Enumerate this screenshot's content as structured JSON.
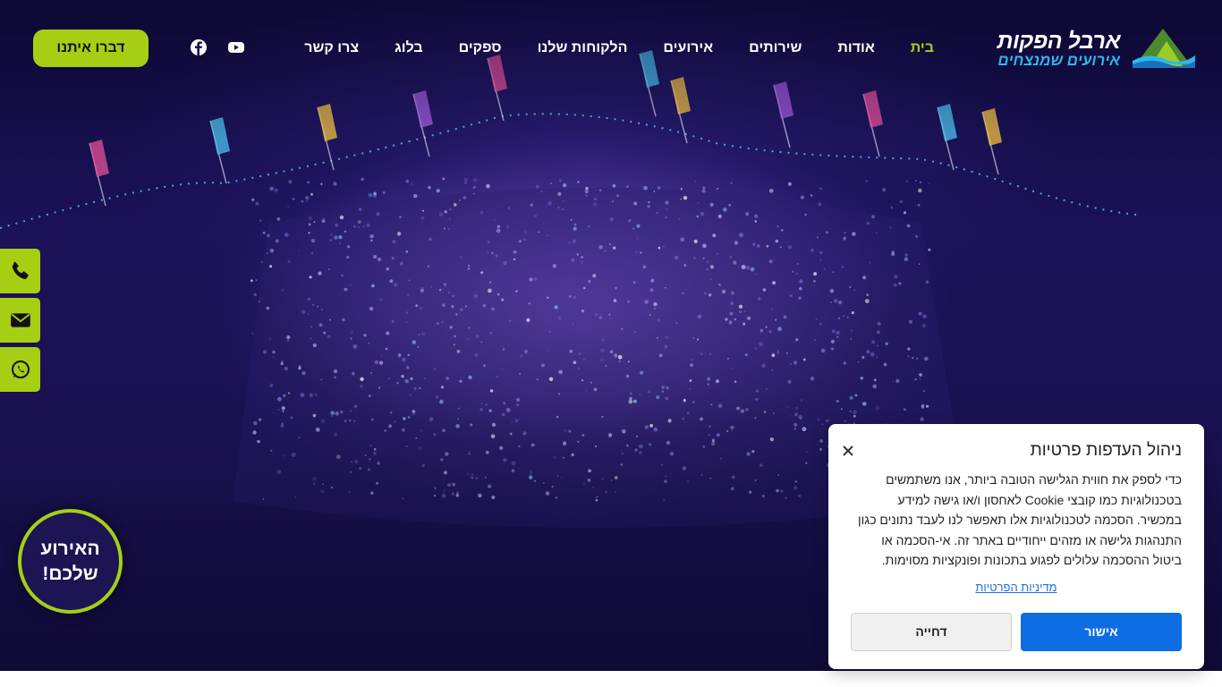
{
  "header": {
    "logo": {
      "title": "ארבל הפקות",
      "subtitle": "אירועים שמנצחים",
      "icon": "mountain-logo-icon"
    },
    "nav": [
      {
        "label": "בית",
        "active": true
      },
      {
        "label": "אודות",
        "active": false
      },
      {
        "label": "שירותים",
        "active": false
      },
      {
        "label": "אירועים",
        "active": false
      },
      {
        "label": "הלקוחות שלנו",
        "active": false
      },
      {
        "label": "ספקים",
        "active": false
      },
      {
        "label": "בלוג",
        "active": false
      },
      {
        "label": "צרו קשר",
        "active": false
      }
    ],
    "social": [
      {
        "icon": "facebook-icon"
      },
      {
        "icon": "youtube-icon"
      }
    ],
    "cta_label": "דברו איתנו"
  },
  "side_buttons": [
    {
      "icon": "phone-icon"
    },
    {
      "icon": "email-icon"
    },
    {
      "icon": "whatsapp-icon"
    }
  ],
  "badge": {
    "line1": "האירוע",
    "line2": "שלכם!"
  },
  "cookie": {
    "title": "ניהול העדפות פרטיות",
    "body": "כדי לספק את חווית הגלישה הטובה ביותר, אנו משתמשים בטכנולוגיות כמו קובצי Cookie לאחסון ו/או גישה למידע במכשיר. הסכמה לטכנולוגיות אלו תאפשר לנו לעבד נתונים כגון התנהגות גלישה או מזהים ייחודיים באתר זה. אי-הסכמה או ביטול ההסכמה עלולים לפגוע בתכונות ופונקציות מסוימות.",
    "policy_link": "מדיניות הפרטיות",
    "accept_label": "אישור",
    "deny_label": "דחייה"
  },
  "colors": {
    "accent": "#a6cf14",
    "primary_button": "#0d6ee3",
    "hero_bg": "#1b1258",
    "logo_sub": "#2fb6ea"
  }
}
